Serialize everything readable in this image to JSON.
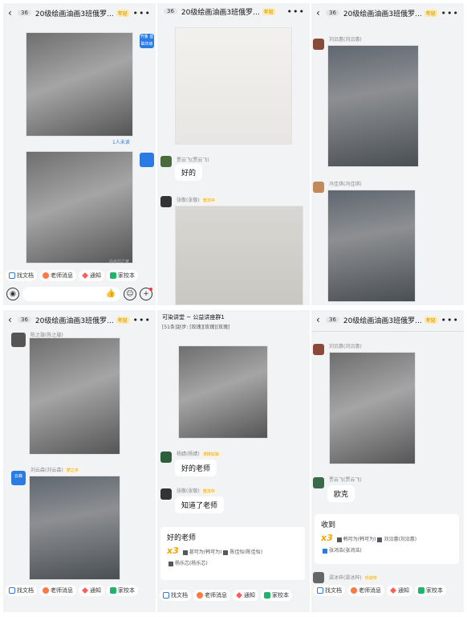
{
  "header": {
    "badge": "36",
    "title": "20级绘画油画3班俄罗...",
    "vip_label": "年轻",
    "more": "•••"
  },
  "panel1": {
    "read_badge": "1人未读",
    "avatar_label": "齐鲁 基础年级",
    "watermark": "@水印之家"
  },
  "panel2": {
    "sender1": "贾云飞(贾云飞)",
    "msg1": "好的",
    "sender2": "张敬(张敬)",
    "sender2_tag": "普法中"
  },
  "panel3": {
    "sender1": "刘沿惠(刘沿惠)",
    "sender2": "冯佳琪(冯佳琪)"
  },
  "panel4": {
    "sender1": "陈之璇(陈之璇)",
    "sender2": "刘云森(刘云森)",
    "sender2_tag": "梦之中",
    "avatar_label": "云森"
  },
  "panel5": {
    "group_title": "可染讲堂 ~ 公益讲座群1",
    "group_sub": "[51条]赵步: [玫瑰][玫瑰][玫瑰]",
    "sender1": "杨婧(杨婧)",
    "sender1_tag": "求拼加油",
    "msg1": "好的老师",
    "sender2": "张敬(张敬)",
    "sender2_tag": "普法中",
    "msg2": "知道了老师",
    "card_title": "好的老师",
    "card_count": "x3",
    "card_line1": "甚可为(韩可为)",
    "card_line1b": "陈佳怡(陈佳怡)",
    "card_line2": "杨乐芯(杨乐芯)"
  },
  "panel6": {
    "sender0": "刘沿惠(刘沿惠)",
    "sender1": "贾云飞(贾云飞)",
    "msg1": "欧克",
    "card_title": "收到",
    "card_count": "x3",
    "card_line1": "韩可为(韩可为)",
    "card_line1b": "刘沿惠(刘沿惠)",
    "card_line2": "张鸿浩(张鸿浩)",
    "sender2": "梁冰梓(梁冰梓)",
    "sender2_tag": "乐动中"
  },
  "toolbar": {
    "doc": "找文档",
    "teacher": "老师消息",
    "notice": "通知",
    "school": "家校本"
  },
  "icons": {
    "mic": "mic-icon",
    "thumb": "thumb-up-icon",
    "emoji": "emoji-icon",
    "plus": "plus-icon"
  }
}
